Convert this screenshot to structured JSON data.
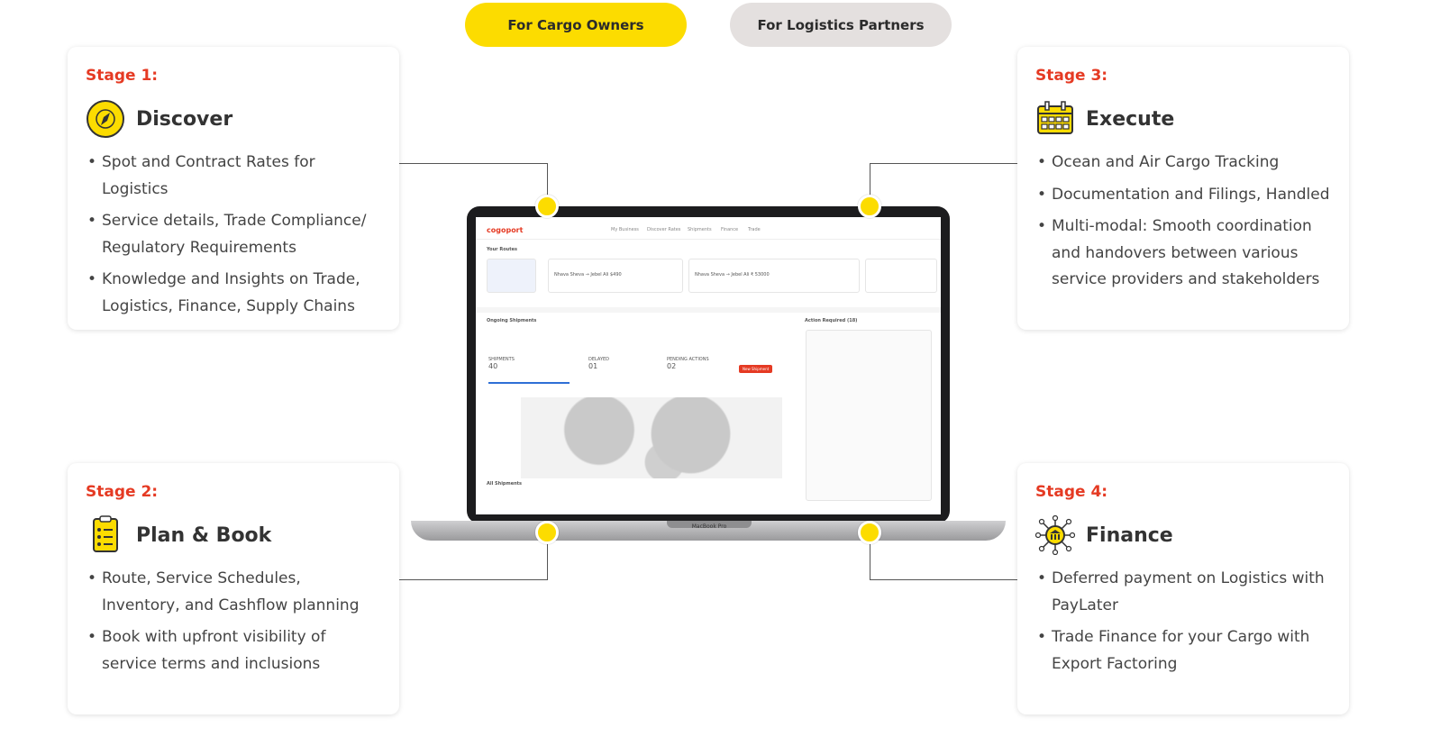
{
  "tabs": {
    "active_label": "For Cargo Owners",
    "inactive_label": "For Logistics Partners"
  },
  "stages": [
    {
      "stage": "Stage 1:",
      "title": "Discover",
      "icon": "compass-icon",
      "bullets": [
        "Spot and Contract Rates for Logistics",
        "Service details, Trade Compliance/ Regulatory Requirements",
        "Knowledge and Insights on Trade, Logistics, Finance, Supply Chains"
      ]
    },
    {
      "stage": "Stage 2:",
      "title": "Plan & Book",
      "icon": "checklist-icon",
      "bullets": [
        "Route, Service Schedules, Inventory, and Cashflow planning",
        "Book with upfront visibility of service terms and inclusions"
      ]
    },
    {
      "stage": "Stage 3:",
      "title": "Execute",
      "icon": "calendar-icon",
      "bullets": [
        "Ocean and Air Cargo Tracking",
        "Documentation and Filings, Handled",
        "Multi-modal: Smooth coordination and handovers between various service providers and stakeholders"
      ]
    },
    {
      "stage": "Stage 4:",
      "title": "Finance",
      "icon": "bank-network-icon",
      "bullets": [
        "Deferred payment on Logistics with PayLater",
        "Trade Finance for your Cargo with Export Factoring"
      ]
    }
  ],
  "laptop": {
    "brand": "MacBook Pro",
    "logo": "cogoport",
    "nav": [
      "My Business",
      "Discover Rates",
      "Shipments",
      "Finance",
      "Trade"
    ],
    "routes_title": "Your Routes",
    "ongoing_title": "Ongoing Shipments",
    "action_title": "Action Required (18)",
    "all_shipments": "All Shipments",
    "shipments_label": "SHIPMENTS",
    "shipments_count": "40",
    "delayed_label": "DELAYED",
    "delayed_count": "01",
    "pending_label": "PENDING ACTIONS",
    "pending_count": "02",
    "new_shipment": "New Shipment",
    "route1": "Nhava Sheva → Jebel Ali  $490",
    "route2": "Nhava Sheva → Jebel Ali  ₹ 53000",
    "accent": "#e53a23"
  },
  "colors": {
    "yellow": "#fcdc00",
    "stage_red": "#e53a23",
    "tab_gray": "#e4e0df"
  }
}
